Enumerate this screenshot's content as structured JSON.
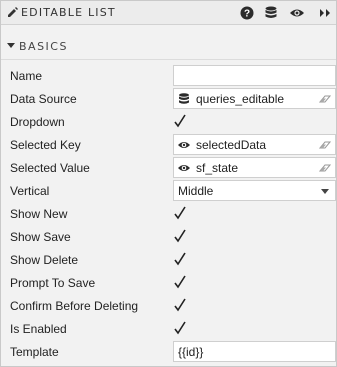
{
  "window": {
    "title": "EDITABLE LIST"
  },
  "toolbar": {
    "icons": [
      "help-icon",
      "database-icon",
      "eye-icon",
      "expand-icon"
    ]
  },
  "section": {
    "label": "BASICS",
    "expanded": true
  },
  "rows": [
    {
      "label": "Name",
      "type": "text",
      "value": ""
    },
    {
      "label": "Data Source",
      "type": "binding",
      "icon": "database-icon",
      "value": "queries_editable"
    },
    {
      "label": "Dropdown",
      "type": "checkbox",
      "checked": true
    },
    {
      "label": "Selected Key",
      "type": "binding",
      "icon": "eye-icon",
      "value": "selectedData"
    },
    {
      "label": "Selected Value",
      "type": "binding",
      "icon": "eye-icon",
      "value": "sf_state"
    },
    {
      "label": "Vertical",
      "type": "select",
      "value": "Middle"
    },
    {
      "label": "Show New",
      "type": "checkbox",
      "checked": true
    },
    {
      "label": "Show Save",
      "type": "checkbox",
      "checked": true
    },
    {
      "label": "Show Delete",
      "type": "checkbox",
      "checked": true
    },
    {
      "label": "Prompt To Save",
      "type": "checkbox",
      "checked": true
    },
    {
      "label": "Confirm Before Deleting",
      "type": "checkbox",
      "checked": true
    },
    {
      "label": "Is Enabled",
      "type": "checkbox",
      "checked": true
    },
    {
      "label": "Template",
      "type": "text",
      "value": "{{id}}"
    }
  ]
}
